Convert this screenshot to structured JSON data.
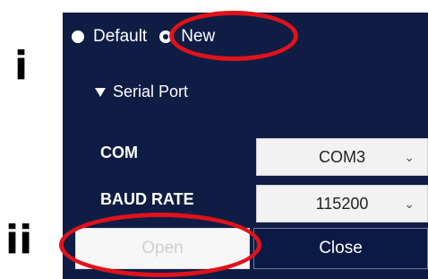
{
  "annotations": {
    "label_i": "i",
    "label_ii": "ii",
    "highlight_color": "#e0121b"
  },
  "mode": {
    "options": [
      "Default",
      "New"
    ],
    "selected": "New"
  },
  "serial_port": {
    "section_title": "Serial Port",
    "com_label": "COM",
    "com_value": "COM3",
    "baud_label": "BAUD RATE",
    "baud_value": "115200"
  },
  "buttons": {
    "open_label": "Open",
    "close_label": "Close"
  },
  "icons": {
    "expand": "triangle-down-icon",
    "dropdown": "chevron-down-icon"
  },
  "colors": {
    "panel_bg": "#0f1d45",
    "open_disabled_text": "#cfcfcf"
  }
}
